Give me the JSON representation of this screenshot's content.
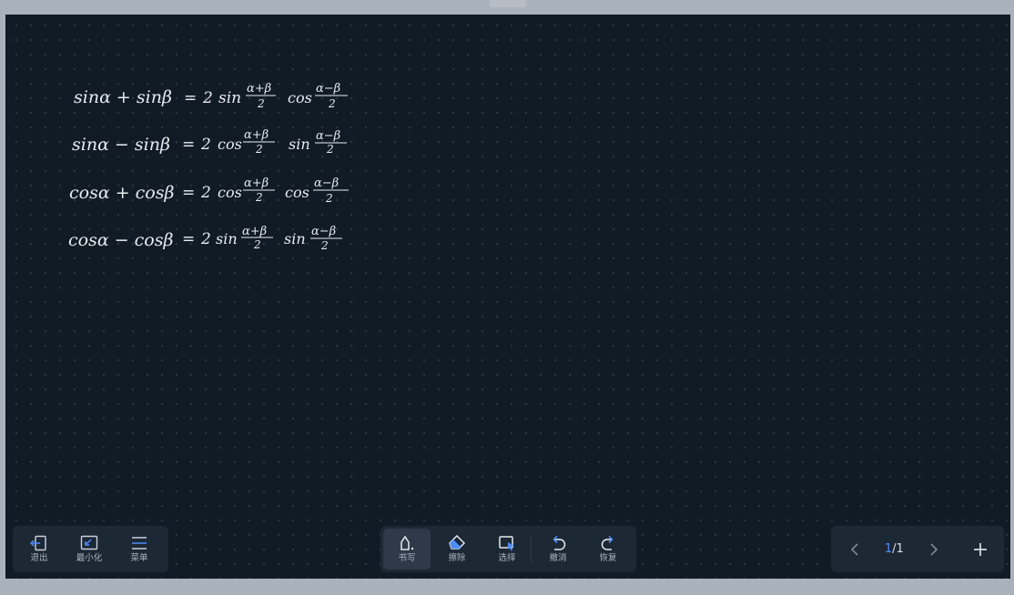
{
  "board": {
    "formulas": [
      {
        "lhs": "sinα + sinβ",
        "eq": "=",
        "coef": "2",
        "f1": "sin",
        "n1": "α+β",
        "d1": "2",
        "f2": "cos",
        "n2": "α−β",
        "d2": "2"
      },
      {
        "lhs": "sinα − sinβ",
        "eq": "=",
        "coef": "2",
        "f1": "cos",
        "n1": "α+β",
        "d1": "2",
        "f2": "sin",
        "n2": "α−β",
        "d2": "2"
      },
      {
        "lhs": "cosα + cosβ",
        "eq": "=",
        "coef": "2",
        "f1": "cos",
        "n1": "α+β",
        "d1": "2",
        "f2": "cos",
        "n2": "α−β",
        "d2": "2"
      },
      {
        "lhs": "cosα − cosβ",
        "eq": "=",
        "coef": "2",
        "f1": "sin",
        "n1": "α+β",
        "d1": "2",
        "f2": "sin",
        "n2": "α−β",
        "d2": "2"
      }
    ]
  },
  "left_toolbar": {
    "exit_label": "退出",
    "minimize_label": "最小化",
    "menu_label": "菜单"
  },
  "center_toolbar": {
    "write_label": "书写",
    "erase_label": "擦除",
    "select_label": "选择",
    "undo_label": "撤消",
    "redo_label": "恢复"
  },
  "pager": {
    "current": "1",
    "total": "/1",
    "prev_icon": "chevron-left-icon",
    "next_icon": "chevron-right-icon",
    "add_icon": "plus-icon"
  },
  "colors": {
    "board_bg": "#111b26",
    "toolbar_bg": "#1d2835",
    "accent": "#4c8dff"
  }
}
